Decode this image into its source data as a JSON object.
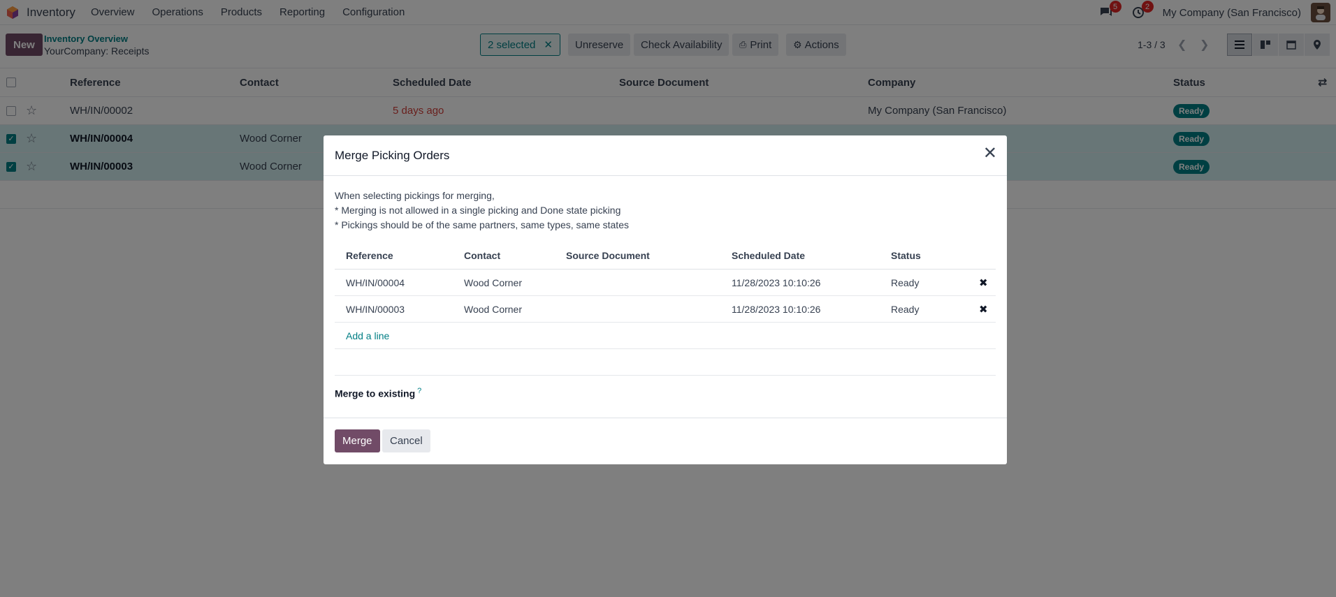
{
  "topnav": {
    "app_name": "Inventory",
    "menu": [
      "Overview",
      "Operations",
      "Products",
      "Reporting",
      "Configuration"
    ],
    "messages_count": "5",
    "activities_count": "2",
    "company": "My Company (San Francisco)"
  },
  "control": {
    "new_label": "New",
    "breadcrumb_parent": "Inventory Overview",
    "breadcrumb_current": "YourCompany: Receipts",
    "selected_label": "2 selected",
    "unreserve_label": "Unreserve",
    "check_availability_label": "Check Availability",
    "print_label": "Print",
    "actions_label": "Actions",
    "pager": "1-3 / 3"
  },
  "list": {
    "headers": {
      "reference": "Reference",
      "contact": "Contact",
      "scheduled_date": "Scheduled Date",
      "source_document": "Source Document",
      "company": "Company",
      "status": "Status"
    },
    "rows": [
      {
        "reference": "WH/IN/00002",
        "contact": "",
        "scheduled_date": "5 days ago",
        "company": "My Company (San Francisco)",
        "status": "Ready",
        "selected": false
      },
      {
        "reference": "WH/IN/00004",
        "contact": "Wood Corner",
        "scheduled_date": "",
        "company": "",
        "status": "Ready",
        "selected": true
      },
      {
        "reference": "WH/IN/00003",
        "contact": "Wood Corner",
        "scheduled_date": "",
        "company": "",
        "status": "Ready",
        "selected": true
      }
    ]
  },
  "modal": {
    "title": "Merge Picking Orders",
    "info_line1": "When selecting pickings for merging,",
    "info_line2": "* Merging is not allowed in a single picking and Done state picking",
    "info_line3": "* Pickings should be of the same partners, same types, same states",
    "headers": {
      "reference": "Reference",
      "contact": "Contact",
      "source_document": "Source Document",
      "scheduled_date": "Scheduled Date",
      "status": "Status"
    },
    "rows": [
      {
        "reference": "WH/IN/00004",
        "contact": "Wood Corner",
        "source_document": "",
        "scheduled_date": "11/28/2023 10:10:26",
        "status": "Ready"
      },
      {
        "reference": "WH/IN/00003",
        "contact": "Wood Corner",
        "source_document": "",
        "scheduled_date": "11/28/2023 10:10:26",
        "status": "Ready"
      }
    ],
    "add_line_label": "Add a line",
    "merge_existing_label": "Merge to existing",
    "help_mark": "?",
    "merge_label": "Merge",
    "cancel_label": "Cancel"
  },
  "colors": {
    "brand": "#714b67",
    "accent": "#017e84",
    "late": "#d23f3a"
  }
}
